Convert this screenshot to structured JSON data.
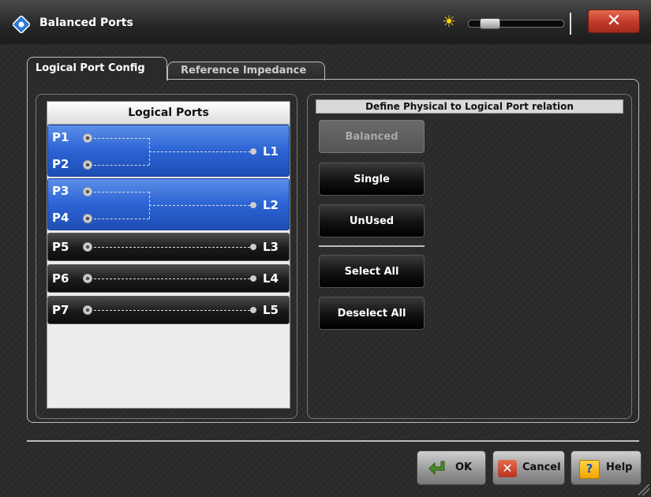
{
  "window": {
    "title": "Balanced Ports"
  },
  "brightness": {
    "level": 0.15
  },
  "tabs": [
    {
      "label": "Logical Port Config",
      "active": true
    },
    {
      "label": "Reference Impedance",
      "active": false
    }
  ],
  "logical_ports": {
    "header": "Logical Ports",
    "groups": [
      {
        "type": "balanced",
        "physical": [
          "P1",
          "P2"
        ],
        "logical": "L1"
      },
      {
        "type": "balanced",
        "physical": [
          "P3",
          "P4"
        ],
        "logical": "L2"
      },
      {
        "type": "single",
        "physical": [
          "P5"
        ],
        "logical": "L3"
      },
      {
        "type": "single",
        "physical": [
          "P6"
        ],
        "logical": "L4"
      },
      {
        "type": "single",
        "physical": [
          "P7"
        ],
        "logical": "L5"
      }
    ]
  },
  "relation": {
    "title": "Define Physical to Logical Port relation",
    "buttons": {
      "balanced": "Balanced",
      "single": "Single",
      "unused": "UnUsed",
      "select_all": "Select All",
      "deselect_all": "Deselect All"
    }
  },
  "footer": {
    "ok": "OK",
    "cancel": "Cancel",
    "help": "Help"
  },
  "colors": {
    "selected_row": "#2c63d4",
    "close_button": "#c0392b"
  }
}
